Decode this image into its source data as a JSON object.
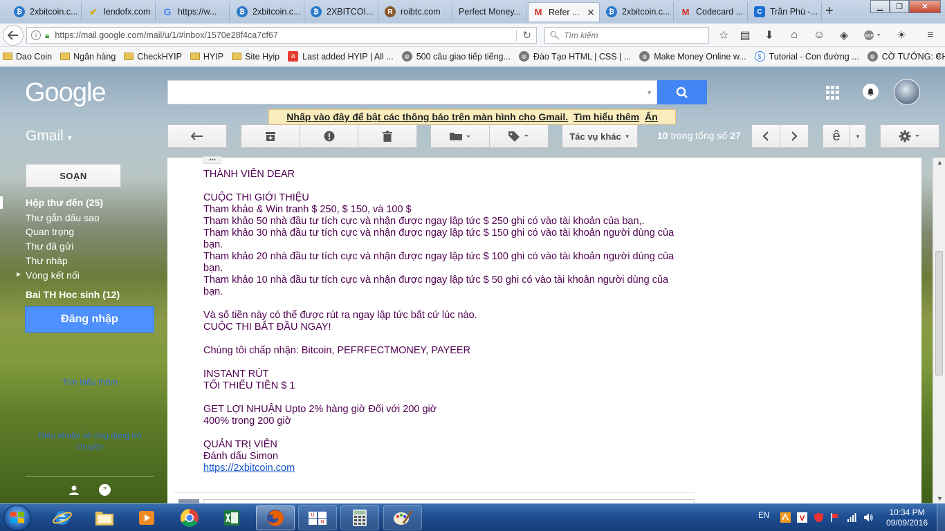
{
  "browser": {
    "tabs": [
      {
        "title": "2xbitcoin.c...",
        "icon": "btc"
      },
      {
        "title": "lendofx.com",
        "icon": "lend"
      },
      {
        "title": "https://w...",
        "icon": "google"
      },
      {
        "title": "2xbitcoin.c...",
        "icon": "btc"
      },
      {
        "title": "2XBITCOI...",
        "icon": "btc"
      },
      {
        "title": "roibtc.com",
        "icon": "roi"
      },
      {
        "title": "Perfect Money...",
        "icon": "blank"
      },
      {
        "title": "Refer ...",
        "icon": "gmail",
        "active": true
      },
      {
        "title": "2xbitcoin.c...",
        "icon": "btc"
      },
      {
        "title": "Codecard ...",
        "icon": "gmail"
      },
      {
        "title": "Trần Phú -...",
        "icon": "c"
      }
    ],
    "url": "https://mail.google.com/mail/u/1/#inbox/1570e28f4ca7cf67",
    "search_placeholder": "Tìm kiếm",
    "bookmarks": [
      {
        "label": "Dao Coin",
        "icon": "folder"
      },
      {
        "label": "Ngân hàng",
        "icon": "folder"
      },
      {
        "label": "CheckHYIP",
        "icon": "folder"
      },
      {
        "label": "HYIP",
        "icon": "folder"
      },
      {
        "label": "Site Hyip",
        "icon": "folder"
      },
      {
        "label": "Last added HYIP | All ...",
        "icon": "a-logo"
      },
      {
        "label": "500 câu giao tiếp tiếng...",
        "icon": "globe"
      },
      {
        "label": "Đào Tạo HTML | CSS | ...",
        "icon": "globe"
      },
      {
        "label": "Make Money Online w...",
        "icon": "globe"
      },
      {
        "label": "Tutorial - Con đường ...",
        "icon": "dollar"
      },
      {
        "label": "CỜ TƯỚNG: CHUYÊN ...",
        "icon": "globe"
      }
    ]
  },
  "gmail": {
    "logo": "Google",
    "notice": {
      "text": "Nhấp vào đây để bật các thông báo trên màn hình cho Gmail.",
      "learn": "Tìm hiểu thêm",
      "hide": "Ẩn"
    },
    "app_label": "Gmail",
    "more_actions": "Tác vụ khác",
    "count": {
      "range": "10",
      "middle": "trong tổng số",
      "total": "27"
    },
    "input_tool": "ê",
    "compose": "SOẠN",
    "nav": [
      {
        "label": "Hộp thư đến (25)",
        "bold": true
      },
      {
        "label": "Thư gắn dấu sao"
      },
      {
        "label": "Quan trọng"
      },
      {
        "label": "Thư đã gửi"
      },
      {
        "label": "Thư nháp"
      },
      {
        "label": "Vòng kết nối"
      },
      {
        "label": "Bai TH Hoc sinh (12)",
        "bold": true
      }
    ],
    "signin": "Đăng nhập",
    "learn_more": "Tìm hiểu thêm",
    "terms": "Điều khoản về ứng dụng trò chuyện",
    "message": {
      "greeting": "THÀNH VIÊN DEAR",
      "contest_title": "CUỘC THI GIỚI THIỆU",
      "lines": [
        "Tham khảo & Win tranh $ 250, $ 150, và 100 $",
        "Tham khảo 50 nhà đầu tư tích cực và nhận được ngay lập tức $ 250 ghi có vào tài khoản của bạn,.",
        "Tham khảo 30 nhà đầu tư tích cực và nhận được ngay lập tức $ 150 ghi có vào tài khoản người dùng của bạn.",
        "Tham khảo 20 nhà đầu tư tích cực và nhận được ngay lập tức $ 100 ghi có vào tài khoản người dùng của bạn.",
        "Tham khảo 10 nhà đầu tư tích cực và nhận được ngay lập tức $ 50 ghi có vào tài khoản người dùng của bạn."
      ],
      "withdraw": "Và số tiền này có thể được rút ra ngay lập tức bất cứ lúc nào.",
      "start": "CUỘC THI BẮT ĐẦU NGAY!",
      "accept": "Chúng tôi chấp nhận: Bitcoin, PEFRFECTMONEY, PAYEER",
      "instant": "INSTANT RÚT",
      "min": "TỐI THIỂU TIỀN $ 1",
      "profit1": "GET LỢI NHUẬN Upto 2% hàng giờ Đối với 200 giờ",
      "profit2": "400% trong 200 giờ",
      "admin": "QUẢN TRỊ VIÊN",
      "sign": "Đánh dấu Simon",
      "link": "https://2xbitcoin.com"
    }
  },
  "taskbar": {
    "lang": "EN",
    "time": "10:34 PM",
    "date": "09/09/2016"
  }
}
